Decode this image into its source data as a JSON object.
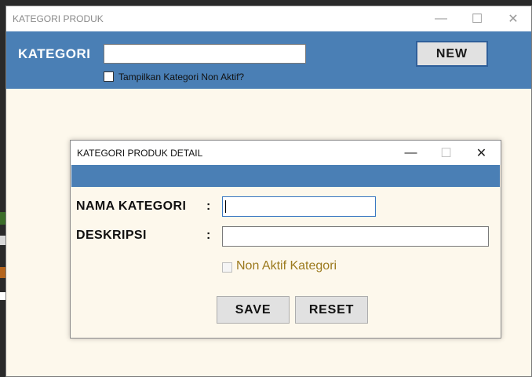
{
  "main_window": {
    "title": "KATEGORI PRODUK",
    "controls": {
      "minimize": "—",
      "maximize": "☐",
      "close": "✕"
    },
    "header": {
      "label": "KATEGORI",
      "search_value": "",
      "new_button": "NEW",
      "show_inactive_checked": false,
      "show_inactive_label": "Tampilkan Kategori Non Aktif?"
    },
    "colors": {
      "band": "#4a7fb5",
      "body": "#fdf8ec"
    }
  },
  "dialog": {
    "title": "KATEGORI PRODUK DETAIL",
    "controls": {
      "minimize": "—",
      "maximize": "☐",
      "close": "✕"
    },
    "fields": {
      "nama_label": "NAMA KATEGORI",
      "deskripsi_label": "DESKRIPSI",
      "colon": ":",
      "nama_value": "",
      "deskripsi_value": ""
    },
    "inactive_checked": false,
    "inactive_label": "Non Aktif Kategori",
    "save_button": "SAVE",
    "reset_button": "RESET"
  }
}
